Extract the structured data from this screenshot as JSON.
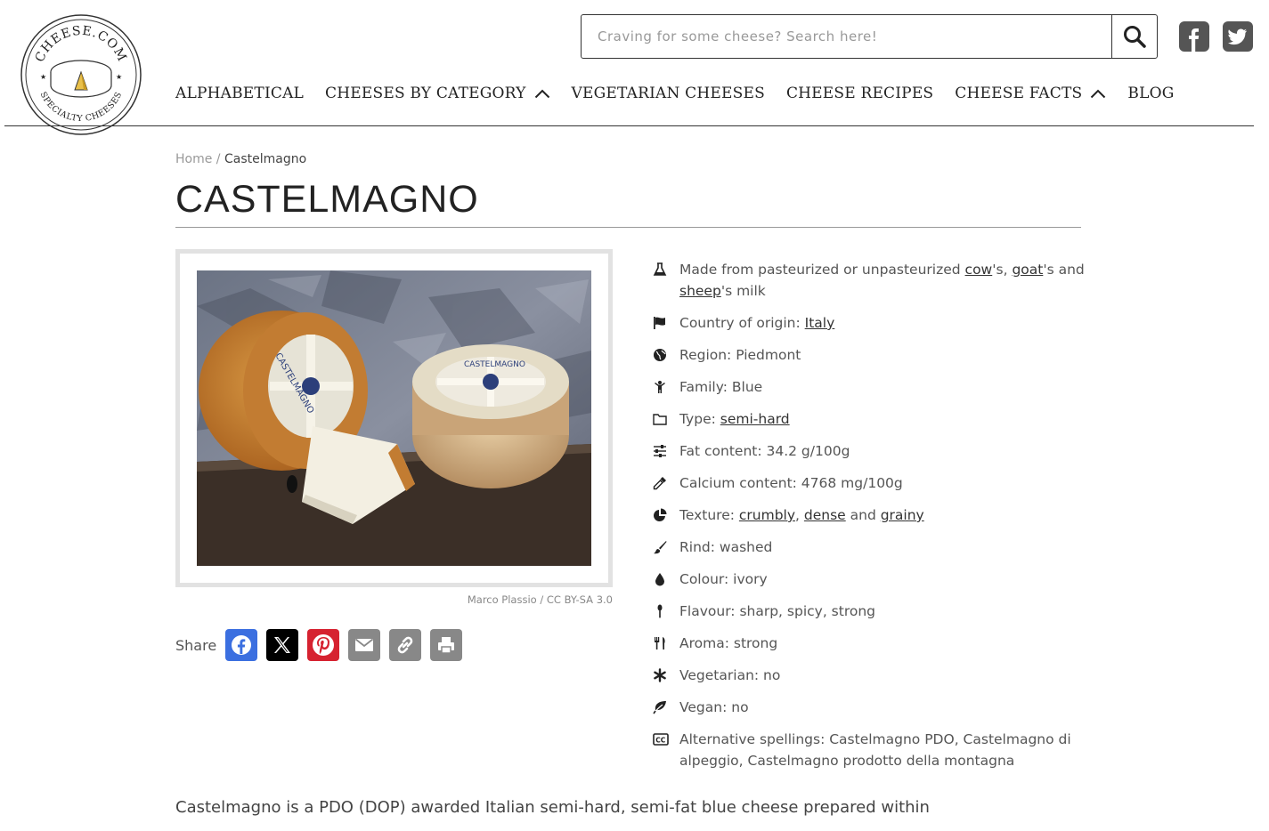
{
  "logo": {
    "text_top": "CHEESE.COM",
    "text_bottom": "SPECIALTY CHEESES"
  },
  "search": {
    "placeholder": "Craving for some cheese? Search here!"
  },
  "social": {
    "facebook_icon": "facebook-square-icon",
    "twitter_icon": "twitter-square-icon"
  },
  "nav": {
    "items": [
      {
        "label": "ALPHABETICAL"
      },
      {
        "label": "CHEESES BY CATEGORY"
      },
      {
        "label": "VEGETARIAN CHEESES"
      },
      {
        "label": "CHEESE RECIPES"
      },
      {
        "label": "CHEESE FACTS"
      },
      {
        "label": "BLOG"
      }
    ]
  },
  "breadcrumb": {
    "home": "Home",
    "separator": "/",
    "current": "Castelmagno"
  },
  "page": {
    "title": "CASTELMAGNO"
  },
  "image": {
    "credit": "Marco Plassio / CC BY-SA 3.0"
  },
  "share": {
    "label": "Share",
    "icons": [
      "facebook-icon",
      "x-icon",
      "pinterest-icon",
      "email-icon",
      "copy-link-icon",
      "print-icon"
    ]
  },
  "facts": {
    "milk": {
      "prefix": "Made from pasteurized or unpasteurized ",
      "cow": "cow",
      "sep1": "'s, ",
      "goat": "goat",
      "sep2": "'s and ",
      "sheep": "sheep",
      "suffix": "'s milk"
    },
    "country": {
      "label": "Country of origin: ",
      "value": "Italy"
    },
    "region": {
      "text": "Region: Piedmont"
    },
    "family": {
      "text": "Family: Blue"
    },
    "type": {
      "label": "Type: ",
      "value": "semi-hard"
    },
    "fat": {
      "text": "Fat content: 34.2 g/100g"
    },
    "calcium": {
      "text": "Calcium content: 4768 mg/100g"
    },
    "texture": {
      "label": "Texture: ",
      "v1": "crumbly",
      "sep1": ", ",
      "v2": "dense",
      "sep2": " and ",
      "v3": "grainy"
    },
    "rind": {
      "text": "Rind: washed"
    },
    "colour": {
      "text": "Colour: ivory"
    },
    "flavour": {
      "text": "Flavour: sharp, spicy, strong"
    },
    "aroma": {
      "text": "Aroma: strong"
    },
    "vegetarian": {
      "text": "Vegetarian: no"
    },
    "vegan": {
      "text": "Vegan: no"
    },
    "alt": {
      "text": "Alternative spellings: Castelmagno PDO, Castelmagno di alpeggio, Castelmagno prodotto della montagna"
    }
  },
  "description": {
    "text": "Castelmagno is a PDO (DOP) awarded Italian semi-hard, semi-fat blue cheese prepared within"
  }
}
